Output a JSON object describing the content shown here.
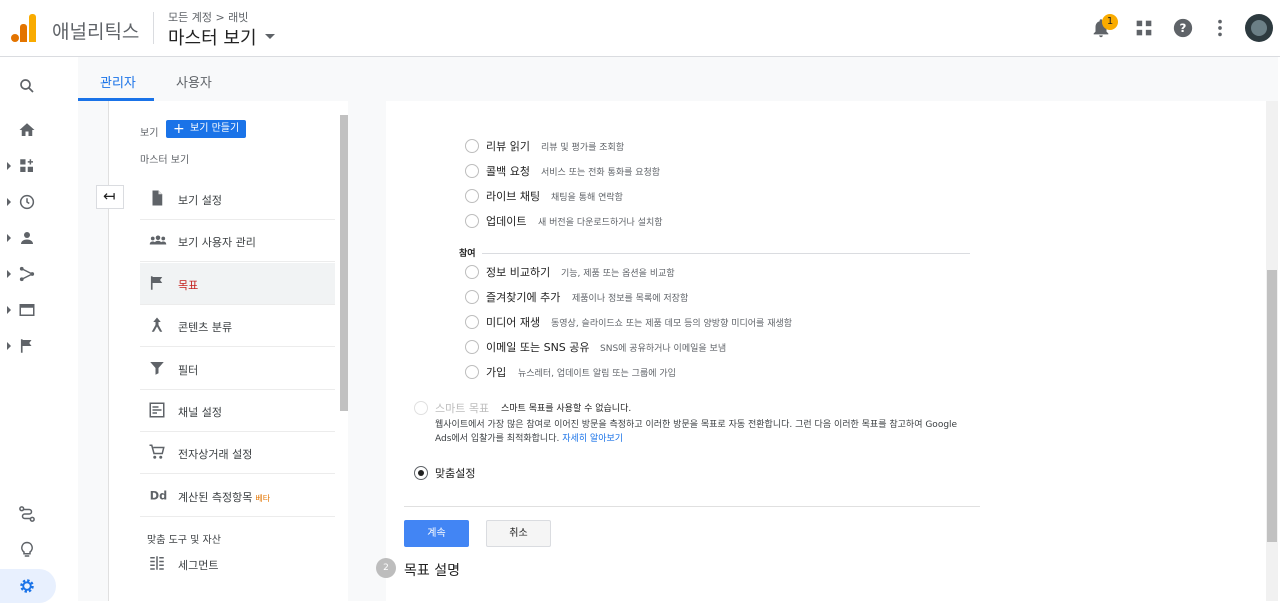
{
  "header": {
    "app_title": "애널리틱스",
    "breadcrumb": "모든 계정 > 래빗",
    "view_title": "마스터 보기",
    "notification_count": "1"
  },
  "tabs": [
    {
      "label": "관리자",
      "active": true
    },
    {
      "label": "사용자",
      "active": false
    }
  ],
  "nav": {
    "view_label": "보기",
    "create_view_label": "보기 만들기",
    "master_view_label": "마스터 보기",
    "items": [
      {
        "label": "보기 설정",
        "icon": "document-icon"
      },
      {
        "label": "보기 사용자 관리",
        "icon": "people-icon"
      },
      {
        "label": "목표",
        "icon": "flag-icon",
        "active": true
      },
      {
        "label": "콘텐츠 분류",
        "icon": "person-arrow-icon"
      },
      {
        "label": "필터",
        "icon": "filter-icon"
      },
      {
        "label": "채널 설정",
        "icon": "channel-icon"
      },
      {
        "label": "전자상거래 설정",
        "icon": "cart-icon"
      },
      {
        "label": "계산된 측정항목",
        "icon": "dd-icon",
        "badge": "베타"
      }
    ],
    "tools_label": "맞춤 도구 및 자산",
    "segment_label": "세그먼트"
  },
  "goal_options": [
    {
      "title": "리뷰 읽기",
      "desc": "리뷰 및 평가를 조회함"
    },
    {
      "title": "콜백 요청",
      "desc": "서비스 또는 전화 통화를 요청함"
    },
    {
      "title": "라이브 채팅",
      "desc": "채팅을 통해 연락함"
    },
    {
      "title": "업데이트",
      "desc": "새 버전을 다운로드하거나 설치함"
    }
  ],
  "engagement": {
    "section_title": "참여",
    "options": [
      {
        "title": "정보 비교하기",
        "desc": "기능, 제품 또는 옵션을 비교함"
      },
      {
        "title": "즐겨찾기에 추가",
        "desc": "제품이나 정보를 목록에 저장함"
      },
      {
        "title": "미디어 재생",
        "desc": "동영상, 슬라이드쇼 또는 제품 데모 등의 양방향 미디어를 재생함"
      },
      {
        "title": "이메일 또는 SNS 공유",
        "desc": "SNS에 공유하거나 이메일을 보냄"
      },
      {
        "title": "가입",
        "desc": "뉴스레터, 업데이트 알림 또는 그룹에 가입"
      }
    ]
  },
  "smart_goal": {
    "title": "스마트 목표",
    "desc": "스마트 목표를 사용할 수 없습니다.",
    "info": "웹사이트에서 가장 많은 참여로 이어진 방문을 측정하고 이러한 방문을 목표로 자동 전환합니다. 그런 다음 이러한 목표를 참고하여 Google Ads에서 입찰가를 최적화합니다.",
    "learn_more": "자세히 알아보기"
  },
  "custom": {
    "title": "맞춤설정",
    "selected": true
  },
  "buttons": {
    "continue": "계속",
    "cancel": "취소"
  },
  "step2": {
    "number": "2",
    "title": "목표 설명"
  },
  "colors": {
    "accent": "#1a73e8",
    "active_nav": "#c5221f",
    "badge": "#f9ab00"
  }
}
